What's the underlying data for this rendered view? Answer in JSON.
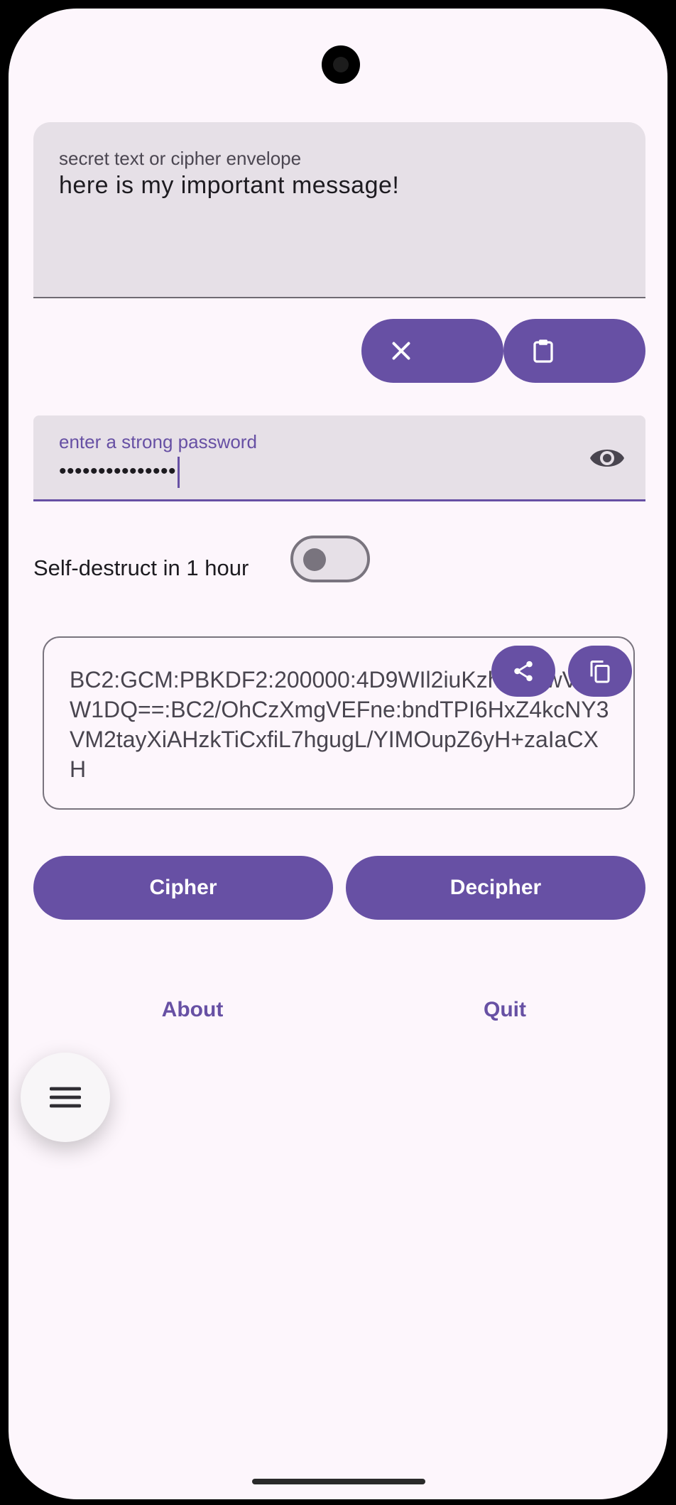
{
  "input": {
    "label": "secret text or cipher envelope",
    "value": "here is my important message!"
  },
  "input_actions": {
    "clear_icon": "close-icon",
    "paste_icon": "clipboard-icon"
  },
  "password": {
    "label": "enter a strong password",
    "value": "•••••••••••••••",
    "toggle_icon": "eye-icon"
  },
  "self_destruct": {
    "label": "Self-destruct in 1 hour",
    "enabled": false
  },
  "output": {
    "text": "BC2:GCM:PBKDF2:200000:4D9WIl2iuKzhaDCwVQW1DQ==:BC2/OhCzXmgVEFne:bndTPI6HxZ4kcNY3VM2tayXiAHzkTiCxfiL7hgugL/YIMOupZ6yH+zaIaCXH",
    "share_icon": "share-icon",
    "copy_icon": "copy-icon"
  },
  "actions": {
    "cipher": "Cipher",
    "decipher": "Decipher",
    "about": "About",
    "quit": "Quit"
  },
  "fab_icon": "menu-icon",
  "colors": {
    "primary": "#6750a4",
    "background": "#fdf6fc",
    "field": "#e6e0e7"
  }
}
